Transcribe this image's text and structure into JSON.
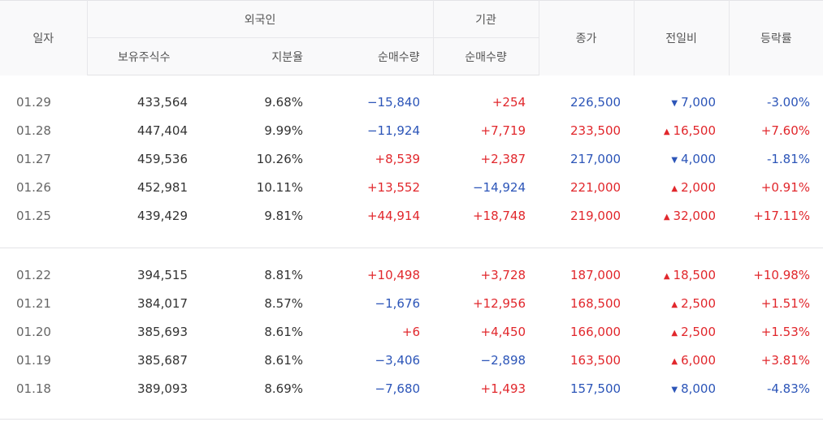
{
  "header": {
    "date": "일자",
    "foreign": "외국인",
    "institution": "기관",
    "close": "종가",
    "change": "전일비",
    "rate": "등락률",
    "holdings": "보유주식수",
    "share_ratio": "지분율",
    "foreign_net": "순매수량",
    "inst_net": "순매수량"
  },
  "colors": {
    "up": "#e1272c",
    "down": "#2c55b8"
  },
  "icons": {
    "up": "triangle-up-icon",
    "down": "triangle-down-icon"
  },
  "groups": [
    [
      {
        "date": "01.29",
        "holdings": "433,564",
        "ratio": "9.68%",
        "fnet": "−15,840",
        "fdir": "down",
        "inet": "+254",
        "idir": "up",
        "close": "226,500",
        "cdir": "down",
        "change": "7,000",
        "rate": "-3.00%"
      },
      {
        "date": "01.28",
        "holdings": "447,404",
        "ratio": "9.99%",
        "fnet": "−11,924",
        "fdir": "down",
        "inet": "+7,719",
        "idir": "up",
        "close": "233,500",
        "cdir": "up",
        "change": "16,500",
        "rate": "+7.60%"
      },
      {
        "date": "01.27",
        "holdings": "459,536",
        "ratio": "10.26%",
        "fnet": "+8,539",
        "fdir": "up",
        "inet": "+2,387",
        "idir": "up",
        "close": "217,000",
        "cdir": "down",
        "change": "4,000",
        "rate": "-1.81%"
      },
      {
        "date": "01.26",
        "holdings": "452,981",
        "ratio": "10.11%",
        "fnet": "+13,552",
        "fdir": "up",
        "inet": "−14,924",
        "idir": "down",
        "close": "221,000",
        "cdir": "up",
        "change": "2,000",
        "rate": "+0.91%"
      },
      {
        "date": "01.25",
        "holdings": "439,429",
        "ratio": "9.81%",
        "fnet": "+44,914",
        "fdir": "up",
        "inet": "+18,748",
        "idir": "up",
        "close": "219,000",
        "cdir": "up",
        "change": "32,000",
        "rate": "+17.11%"
      }
    ],
    [
      {
        "date": "01.22",
        "holdings": "394,515",
        "ratio": "8.81%",
        "fnet": "+10,498",
        "fdir": "up",
        "inet": "+3,728",
        "idir": "up",
        "close": "187,000",
        "cdir": "up",
        "change": "18,500",
        "rate": "+10.98%"
      },
      {
        "date": "01.21",
        "holdings": "384,017",
        "ratio": "8.57%",
        "fnet": "−1,676",
        "fdir": "down",
        "inet": "+12,956",
        "idir": "up",
        "close": "168,500",
        "cdir": "up",
        "change": "2,500",
        "rate": "+1.51%"
      },
      {
        "date": "01.20",
        "holdings": "385,693",
        "ratio": "8.61%",
        "fnet": "+6",
        "fdir": "up",
        "inet": "+4,450",
        "idir": "up",
        "close": "166,000",
        "cdir": "up",
        "change": "2,500",
        "rate": "+1.53%"
      },
      {
        "date": "01.19",
        "holdings": "385,687",
        "ratio": "8.61%",
        "fnet": "−3,406",
        "fdir": "down",
        "inet": "−2,898",
        "idir": "down",
        "close": "163,500",
        "cdir": "up",
        "change": "6,000",
        "rate": "+3.81%"
      },
      {
        "date": "01.18",
        "holdings": "389,093",
        "ratio": "8.69%",
        "fnet": "−7,680",
        "fdir": "down",
        "inet": "+1,493",
        "idir": "up",
        "close": "157,500",
        "cdir": "down",
        "change": "8,000",
        "rate": "-4.83%"
      }
    ]
  ]
}
